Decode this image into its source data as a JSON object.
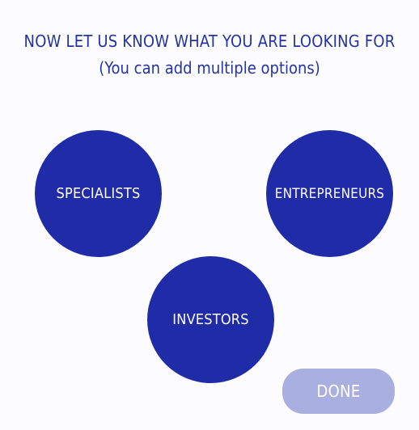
{
  "header": {
    "title": "NOW LET US KNOW WHAT YOU ARE LOOKING FOR",
    "subtitle": "(You can add multiple options)"
  },
  "options": [
    {
      "label": "SPECIALISTS"
    },
    {
      "label": "ENTREPRENEURS"
    },
    {
      "label": "INVESTORS"
    }
  ],
  "actions": {
    "done_label": "DONE"
  },
  "colors": {
    "accent": "#1f2ba7",
    "heading_text": "#2433a3",
    "done_disabled_bg": "#a9b0df",
    "background": "#fcfcfe"
  }
}
